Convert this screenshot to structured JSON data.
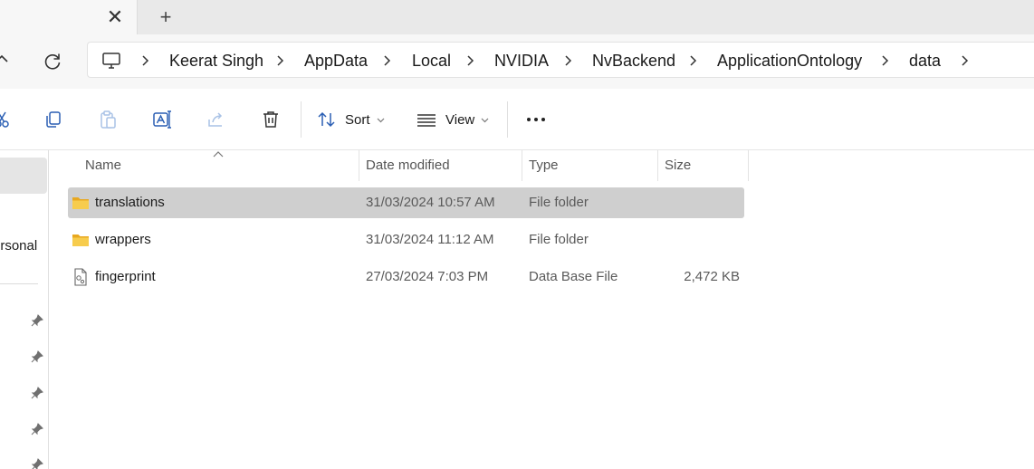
{
  "tabs": {
    "close_symbol": "✕",
    "new_tab_symbol": "+"
  },
  "breadcrumb": {
    "root_icon": "computer-icon",
    "items": [
      "Keerat Singh",
      "AppData",
      "Local",
      "NVIDIA",
      "NvBackend",
      "ApplicationOntology",
      "data"
    ]
  },
  "toolbar": {
    "icons": [
      "cut-icon",
      "copy-icon",
      "paste-icon",
      "rename-icon",
      "share-icon",
      "delete-icon"
    ],
    "sort_label": "Sort",
    "view_label": "View",
    "more_icon": "more-options-icon"
  },
  "nav": {
    "visible_label": "ersonal",
    "pins": 5
  },
  "columns": {
    "name": "Name",
    "date": "Date modified",
    "type": "Type",
    "size": "Size"
  },
  "files": [
    {
      "name": "translations",
      "date": "31/03/2024 10:57 AM",
      "type": "File folder",
      "size": "",
      "icon": "folder-icon",
      "selected": true
    },
    {
      "name": "wrappers",
      "date": "31/03/2024 11:12 AM",
      "type": "File folder",
      "size": "",
      "icon": "folder-icon",
      "selected": false
    },
    {
      "name": "fingerprint",
      "date": "27/03/2024 7:03 PM",
      "type": "Data Base File",
      "size": "2,472 KB",
      "icon": "database-file-icon",
      "selected": false
    }
  ],
  "colors": {
    "selection": "#cfcfcf",
    "folder": "#f3c13a",
    "chrome": "#f7f7f7"
  }
}
